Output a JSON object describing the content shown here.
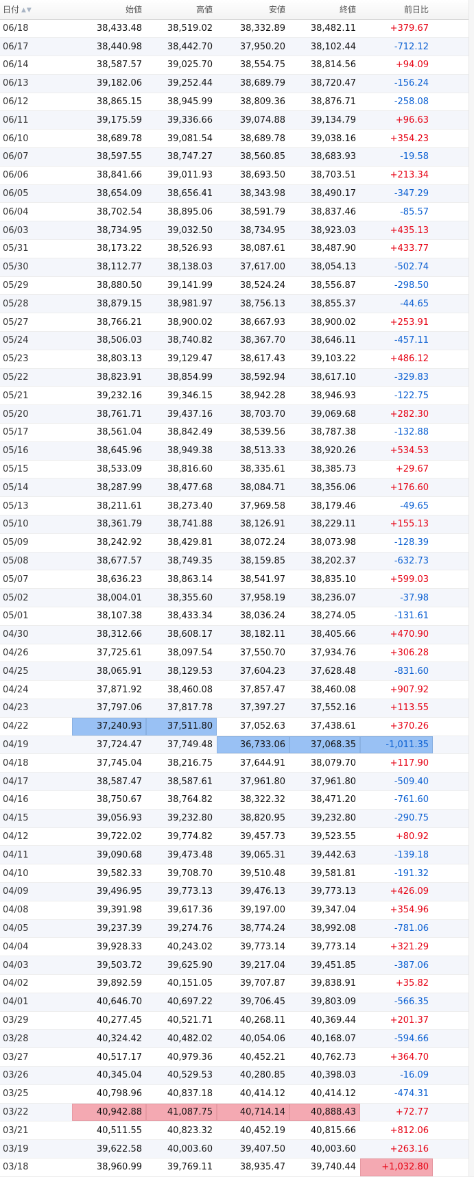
{
  "table": {
    "headers": {
      "date": "日付",
      "open": "始値",
      "high": "高値",
      "low": "安値",
      "close": "終値",
      "change": "前日比"
    },
    "sort_icon": "▲▼",
    "rows": [
      {
        "date": "06/18",
        "open": "38,433.48",
        "high": "38,519.02",
        "low": "38,332.89",
        "close": "38,482.11",
        "change": "+379.67"
      },
      {
        "date": "06/17",
        "open": "38,440.98",
        "high": "38,442.70",
        "low": "37,950.20",
        "close": "38,102.44",
        "change": "-712.12"
      },
      {
        "date": "06/14",
        "open": "38,587.57",
        "high": "39,025.70",
        "low": "38,554.75",
        "close": "38,814.56",
        "change": "+94.09"
      },
      {
        "date": "06/13",
        "open": "39,182.06",
        "high": "39,252.44",
        "low": "38,689.79",
        "close": "38,720.47",
        "change": "-156.24"
      },
      {
        "date": "06/12",
        "open": "38,865.15",
        "high": "38,945.99",
        "low": "38,809.36",
        "close": "38,876.71",
        "change": "-258.08"
      },
      {
        "date": "06/11",
        "open": "39,175.59",
        "high": "39,336.66",
        "low": "39,074.88",
        "close": "39,134.79",
        "change": "+96.63"
      },
      {
        "date": "06/10",
        "open": "38,689.78",
        "high": "39,081.54",
        "low": "38,689.78",
        "close": "39,038.16",
        "change": "+354.23"
      },
      {
        "date": "06/07",
        "open": "38,597.55",
        "high": "38,747.27",
        "low": "38,560.85",
        "close": "38,683.93",
        "change": "-19.58"
      },
      {
        "date": "06/06",
        "open": "38,841.66",
        "high": "39,011.93",
        "low": "38,693.50",
        "close": "38,703.51",
        "change": "+213.34"
      },
      {
        "date": "06/05",
        "open": "38,654.09",
        "high": "38,656.41",
        "low": "38,343.98",
        "close": "38,490.17",
        "change": "-347.29"
      },
      {
        "date": "06/04",
        "open": "38,702.54",
        "high": "38,895.06",
        "low": "38,591.79",
        "close": "38,837.46",
        "change": "-85.57"
      },
      {
        "date": "06/03",
        "open": "38,734.95",
        "high": "39,032.50",
        "low": "38,734.95",
        "close": "38,923.03",
        "change": "+435.13"
      },
      {
        "date": "05/31",
        "open": "38,173.22",
        "high": "38,526.93",
        "low": "38,087.61",
        "close": "38,487.90",
        "change": "+433.77"
      },
      {
        "date": "05/30",
        "open": "38,112.77",
        "high": "38,138.03",
        "low": "37,617.00",
        "close": "38,054.13",
        "change": "-502.74"
      },
      {
        "date": "05/29",
        "open": "38,880.50",
        "high": "39,141.99",
        "low": "38,524.24",
        "close": "38,556.87",
        "change": "-298.50"
      },
      {
        "date": "05/28",
        "open": "38,879.15",
        "high": "38,981.97",
        "low": "38,756.13",
        "close": "38,855.37",
        "change": "-44.65"
      },
      {
        "date": "05/27",
        "open": "38,766.21",
        "high": "38,900.02",
        "low": "38,667.93",
        "close": "38,900.02",
        "change": "+253.91"
      },
      {
        "date": "05/24",
        "open": "38,506.03",
        "high": "38,740.82",
        "low": "38,367.70",
        "close": "38,646.11",
        "change": "-457.11"
      },
      {
        "date": "05/23",
        "open": "38,803.13",
        "high": "39,129.47",
        "low": "38,617.43",
        "close": "39,103.22",
        "change": "+486.12"
      },
      {
        "date": "05/22",
        "open": "38,823.91",
        "high": "38,854.99",
        "low": "38,592.94",
        "close": "38,617.10",
        "change": "-329.83"
      },
      {
        "date": "05/21",
        "open": "39,232.16",
        "high": "39,346.15",
        "low": "38,942.28",
        "close": "38,946.93",
        "change": "-122.75"
      },
      {
        "date": "05/20",
        "open": "38,761.71",
        "high": "39,437.16",
        "low": "38,703.70",
        "close": "39,069.68",
        "change": "+282.30"
      },
      {
        "date": "05/17",
        "open": "38,561.04",
        "high": "38,842.49",
        "low": "38,539.56",
        "close": "38,787.38",
        "change": "-132.88"
      },
      {
        "date": "05/16",
        "open": "38,645.96",
        "high": "38,949.38",
        "low": "38,513.33",
        "close": "38,920.26",
        "change": "+534.53"
      },
      {
        "date": "05/15",
        "open": "38,533.09",
        "high": "38,816.60",
        "low": "38,335.61",
        "close": "38,385.73",
        "change": "+29.67"
      },
      {
        "date": "05/14",
        "open": "38,287.99",
        "high": "38,477.68",
        "low": "38,084.71",
        "close": "38,356.06",
        "change": "+176.60"
      },
      {
        "date": "05/13",
        "open": "38,211.61",
        "high": "38,273.40",
        "low": "37,969.58",
        "close": "38,179.46",
        "change": "-49.65"
      },
      {
        "date": "05/10",
        "open": "38,361.79",
        "high": "38,741.88",
        "low": "38,126.91",
        "close": "38,229.11",
        "change": "+155.13"
      },
      {
        "date": "05/09",
        "open": "38,242.92",
        "high": "38,429.81",
        "low": "38,072.24",
        "close": "38,073.98",
        "change": "-128.39"
      },
      {
        "date": "05/08",
        "open": "38,677.57",
        "high": "38,749.35",
        "low": "38,159.85",
        "close": "38,202.37",
        "change": "-632.73"
      },
      {
        "date": "05/07",
        "open": "38,636.23",
        "high": "38,863.14",
        "low": "38,541.97",
        "close": "38,835.10",
        "change": "+599.03"
      },
      {
        "date": "05/02",
        "open": "38,004.01",
        "high": "38,355.60",
        "low": "37,958.19",
        "close": "38,236.07",
        "change": "-37.98"
      },
      {
        "date": "05/01",
        "open": "38,107.38",
        "high": "38,433.34",
        "low": "38,036.24",
        "close": "38,274.05",
        "change": "-131.61"
      },
      {
        "date": "04/30",
        "open": "38,312.66",
        "high": "38,608.17",
        "low": "38,182.11",
        "close": "38,405.66",
        "change": "+470.90"
      },
      {
        "date": "04/26",
        "open": "37,725.61",
        "high": "38,097.54",
        "low": "37,550.70",
        "close": "37,934.76",
        "change": "+306.28"
      },
      {
        "date": "04/25",
        "open": "38,065.91",
        "high": "38,129.53",
        "low": "37,604.23",
        "close": "37,628.48",
        "change": "-831.60"
      },
      {
        "date": "04/24",
        "open": "37,871.92",
        "high": "38,460.08",
        "low": "37,857.47",
        "close": "38,460.08",
        "change": "+907.92"
      },
      {
        "date": "04/23",
        "open": "37,797.06",
        "high": "37,817.78",
        "low": "37,397.27",
        "close": "37,552.16",
        "change": "+113.55"
      },
      {
        "date": "04/22",
        "open": "37,240.93",
        "high": "37,511.80",
        "low": "37,052.63",
        "close": "37,438.61",
        "change": "+370.26"
      },
      {
        "date": "04/19",
        "open": "37,724.47",
        "high": "37,749.48",
        "low": "36,733.06",
        "close": "37,068.35",
        "change": "-1,011.35"
      },
      {
        "date": "04/18",
        "open": "37,745.04",
        "high": "38,216.75",
        "low": "37,644.91",
        "close": "38,079.70",
        "change": "+117.90"
      },
      {
        "date": "04/17",
        "open": "38,587.47",
        "high": "38,587.61",
        "low": "37,961.80",
        "close": "37,961.80",
        "change": "-509.40"
      },
      {
        "date": "04/16",
        "open": "38,750.67",
        "high": "38,764.82",
        "low": "38,322.32",
        "close": "38,471.20",
        "change": "-761.60"
      },
      {
        "date": "04/15",
        "open": "39,056.93",
        "high": "39,232.80",
        "low": "38,820.95",
        "close": "39,232.80",
        "change": "-290.75"
      },
      {
        "date": "04/12",
        "open": "39,722.02",
        "high": "39,774.82",
        "low": "39,457.73",
        "close": "39,523.55",
        "change": "+80.92"
      },
      {
        "date": "04/11",
        "open": "39,090.68",
        "high": "39,473.48",
        "low": "39,065.31",
        "close": "39,442.63",
        "change": "-139.18"
      },
      {
        "date": "04/10",
        "open": "39,582.33",
        "high": "39,708.70",
        "low": "39,510.48",
        "close": "39,581.81",
        "change": "-191.32"
      },
      {
        "date": "04/09",
        "open": "39,496.95",
        "high": "39,773.13",
        "low": "39,476.13",
        "close": "39,773.13",
        "change": "+426.09"
      },
      {
        "date": "04/08",
        "open": "39,391.98",
        "high": "39,617.36",
        "low": "39,197.00",
        "close": "39,347.04",
        "change": "+354.96"
      },
      {
        "date": "04/05",
        "open": "39,237.39",
        "high": "39,274.76",
        "low": "38,774.24",
        "close": "38,992.08",
        "change": "-781.06"
      },
      {
        "date": "04/04",
        "open": "39,928.33",
        "high": "40,243.02",
        "low": "39,773.14",
        "close": "39,773.14",
        "change": "+321.29"
      },
      {
        "date": "04/03",
        "open": "39,503.72",
        "high": "39,625.90",
        "low": "39,217.04",
        "close": "39,451.85",
        "change": "-387.06"
      },
      {
        "date": "04/02",
        "open": "39,892.59",
        "high": "40,151.05",
        "low": "39,707.87",
        "close": "39,838.91",
        "change": "+35.82"
      },
      {
        "date": "04/01",
        "open": "40,646.70",
        "high": "40,697.22",
        "low": "39,706.45",
        "close": "39,803.09",
        "change": "-566.35"
      },
      {
        "date": "03/29",
        "open": "40,277.45",
        "high": "40,521.71",
        "low": "40,268.11",
        "close": "40,369.44",
        "change": "+201.37"
      },
      {
        "date": "03/28",
        "open": "40,324.42",
        "high": "40,482.02",
        "low": "40,054.06",
        "close": "40,168.07",
        "change": "-594.66"
      },
      {
        "date": "03/27",
        "open": "40,517.17",
        "high": "40,979.36",
        "low": "40,452.21",
        "close": "40,762.73",
        "change": "+364.70"
      },
      {
        "date": "03/26",
        "open": "40,345.04",
        "high": "40,529.53",
        "low": "40,280.85",
        "close": "40,398.03",
        "change": "-16.09"
      },
      {
        "date": "03/25",
        "open": "40,798.96",
        "high": "40,837.18",
        "low": "40,414.12",
        "close": "40,414.12",
        "change": "-474.31"
      },
      {
        "date": "03/22",
        "open": "40,942.88",
        "high": "41,087.75",
        "low": "40,714.14",
        "close": "40,888.43",
        "change": "+72.77"
      },
      {
        "date": "03/21",
        "open": "40,511.55",
        "high": "40,823.32",
        "low": "40,452.19",
        "close": "40,815.66",
        "change": "+812.06"
      },
      {
        "date": "03/19",
        "open": "39,622.58",
        "high": "40,003.60",
        "low": "39,407.50",
        "close": "40,003.60",
        "change": "+263.16"
      },
      {
        "date": "03/18",
        "open": "38,960.99",
        "high": "39,769.11",
        "low": "38,935.47",
        "close": "39,740.44",
        "change": "+1,032.80"
      }
    ],
    "highlights": {
      "blue": [
        [
          38,
          "open"
        ],
        [
          38,
          "high"
        ],
        [
          39,
          "low"
        ],
        [
          39,
          "close"
        ],
        [
          39,
          "change"
        ]
      ],
      "red": [
        [
          59,
          "open"
        ],
        [
          59,
          "high"
        ],
        [
          59,
          "low"
        ],
        [
          59,
          "close"
        ],
        [
          62,
          "change"
        ]
      ]
    },
    "colors": {
      "positive": "#e60012",
      "negative": "#0a5fd2",
      "highlight_blue": "#99c1f4",
      "highlight_red": "#f4a9b2"
    }
  }
}
